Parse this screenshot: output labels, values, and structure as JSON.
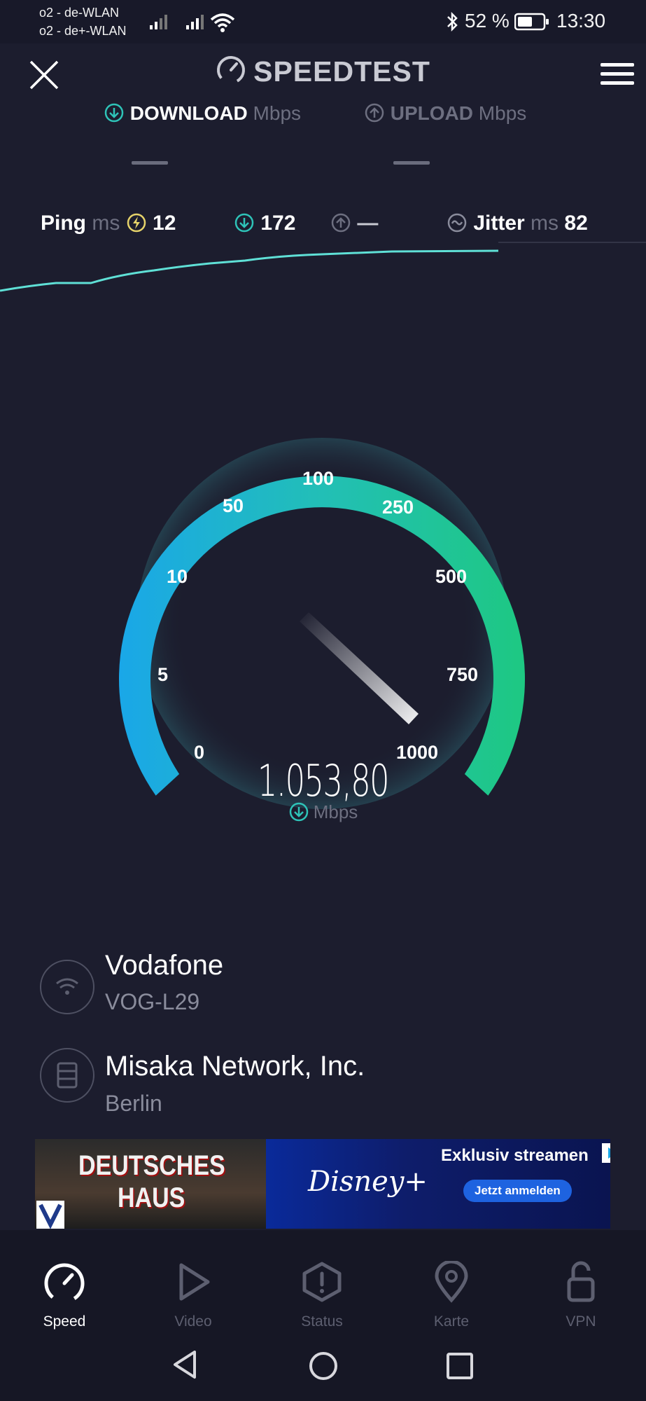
{
  "status_bar": {
    "carrier_1": "o2 - de-WLAN",
    "carrier_2": "o2 - de+-WLAN",
    "battery": "52 %",
    "time": "13:30"
  },
  "header": {
    "title": "SPEEDTEST"
  },
  "tabs": {
    "download_label": "DOWNLOAD",
    "download_unit": "Mbps",
    "upload_label": "UPLOAD",
    "upload_unit": "Mbps"
  },
  "metrics": {
    "ping_label": "Ping",
    "ping_unit": "ms",
    "ping_value": "12",
    "download_latency": "172",
    "upload_latency": "—",
    "jitter_label": "Jitter",
    "jitter_unit": "ms",
    "jitter_value": "82"
  },
  "gauge": {
    "ticks": [
      "0",
      "5",
      "10",
      "50",
      "100",
      "250",
      "500",
      "750",
      "1000"
    ],
    "reading": "1.053,80",
    "unit": "Mbps"
  },
  "provider": {
    "isp": "Vodafone",
    "device": "VOG-L29",
    "server": "Misaka Network, Inc.",
    "location": "Berlin"
  },
  "ad": {
    "left_text_1": "DEUTSCHES",
    "left_text_2": "HAUS",
    "brand": "Disney+",
    "headline": "Exklusiv streamen",
    "cta": "Jetzt anmelden"
  },
  "nav": {
    "items": [
      {
        "label": "Speed",
        "icon": "speed-icon",
        "active": true
      },
      {
        "label": "Video",
        "icon": "play-icon",
        "active": false
      },
      {
        "label": "Status",
        "icon": "alert-icon",
        "active": false
      },
      {
        "label": "Karte",
        "icon": "map-pin-icon",
        "active": false
      },
      {
        "label": "VPN",
        "icon": "unlock-icon",
        "active": false
      }
    ]
  },
  "colors": {
    "background": "#1c1d2e",
    "accent_teal": "#2ec3b8",
    "gauge_start": "#1aa7e8",
    "gauge_end": "#1ec882",
    "muted": "#6d6f80"
  }
}
